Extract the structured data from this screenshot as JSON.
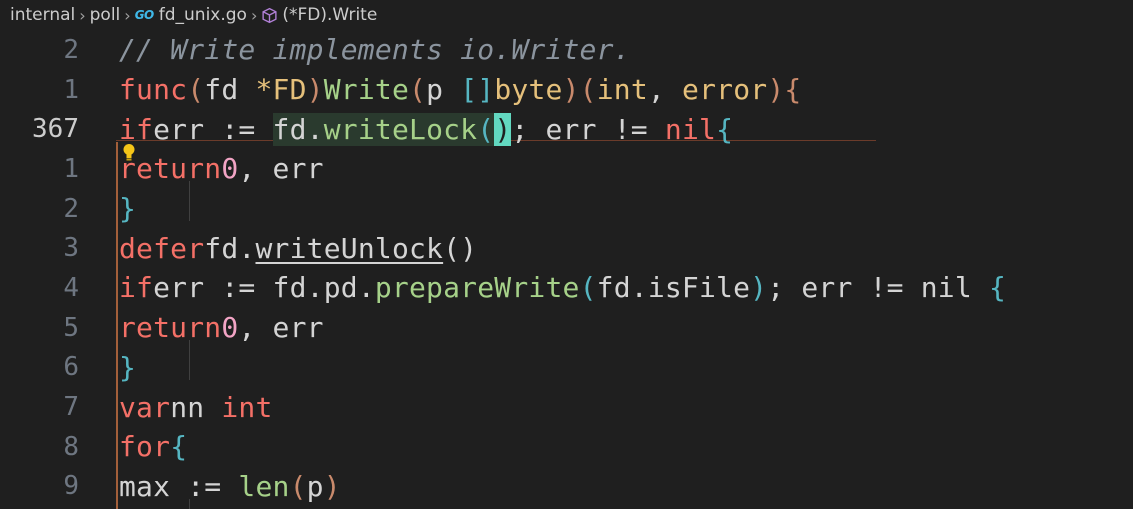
{
  "breadcrumb": {
    "items": [
      "internal",
      "poll",
      "fd_unix.go",
      "(*FD).Write"
    ],
    "go_badge": "GO"
  },
  "editor": {
    "line_numbers": [
      "2",
      "1",
      "367",
      "1",
      "2",
      "3",
      "4",
      "5",
      "6",
      "7",
      "8",
      "9"
    ],
    "active_line_number": "367",
    "lines": [
      "// Write implements io.Writer.",
      "func (fd *FD) Write(p []byte) (int, error) {",
      "    if err := fd.writeLock(); err != nil {",
      "        return 0, err",
      "    }",
      "    defer fd.writeUnlock()",
      "    if err := fd.pd.prepareWrite(fd.isFile); err != nil {",
      "        return 0, err",
      "    }",
      "    var nn int",
      "    for {",
      "        max := len(p)"
    ]
  },
  "colors": {
    "background": "#1f1f1f",
    "keyword": "#f47067",
    "function": "#a6d189",
    "type": "#e5c07b",
    "number": "#f2a4c5",
    "comment": "#8b949e",
    "cursor": "#62d8c0"
  },
  "icons": [
    "chevron-right-icon",
    "go-file-icon",
    "method-cube-icon",
    "lightbulb-icon"
  ]
}
